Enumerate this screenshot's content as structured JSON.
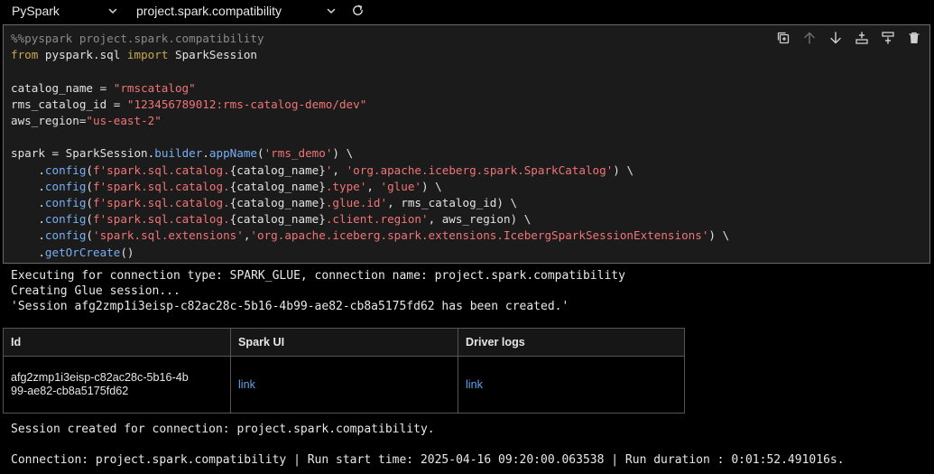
{
  "toolbar": {
    "kernel": "PySpark",
    "connection": "project.spark.compatibility",
    "icons": [
      "chevron-down-icon",
      "refresh-icon"
    ]
  },
  "cell": {
    "actions": [
      {
        "name": "duplicate-cell-icon"
      },
      {
        "name": "move-up-icon"
      },
      {
        "name": "move-down-icon"
      },
      {
        "name": "insert-above-icon"
      },
      {
        "name": "insert-below-icon"
      },
      {
        "name": "delete-icon"
      }
    ],
    "code_lines": [
      [
        {
          "t": "%%pyspark project.spark.compatibility",
          "c": "magic"
        }
      ],
      [
        {
          "t": "from",
          "c": "kw"
        },
        {
          "t": " pyspark.sql ",
          "c": "plain"
        },
        {
          "t": "import",
          "c": "kw"
        },
        {
          "t": " SparkSession",
          "c": "plain"
        }
      ],
      [],
      [
        {
          "t": "catalog_name = ",
          "c": "plain"
        },
        {
          "t": "\"rmscatalog\"",
          "c": "str"
        }
      ],
      [
        {
          "t": "rms_catalog_id = ",
          "c": "plain"
        },
        {
          "t": "\"123456789012:rms-catalog-demo/dev\"",
          "c": "str"
        }
      ],
      [
        {
          "t": "aws_region=",
          "c": "plain"
        },
        {
          "t": "\"us-east-2\"",
          "c": "str"
        }
      ],
      [],
      [
        {
          "t": "spark = SparkSession.",
          "c": "plain"
        },
        {
          "t": "builder",
          "c": "fn"
        },
        {
          "t": ".",
          "c": "plain"
        },
        {
          "t": "appName",
          "c": "fn"
        },
        {
          "t": "(",
          "c": "plain"
        },
        {
          "t": "'rms_demo'",
          "c": "str"
        },
        {
          "t": ") \\",
          "c": "plain"
        }
      ],
      [
        {
          "t": "    .",
          "c": "plain"
        },
        {
          "t": "config",
          "c": "fn"
        },
        {
          "t": "(",
          "c": "plain"
        },
        {
          "t": "f'spark.sql.catalog.",
          "c": "str"
        },
        {
          "t": "{catalog_name}",
          "c": "plain"
        },
        {
          "t": "'",
          "c": "str"
        },
        {
          "t": ", ",
          "c": "plain"
        },
        {
          "t": "'org.apache.iceberg.spark.SparkCatalog'",
          "c": "str"
        },
        {
          "t": ") \\",
          "c": "plain"
        }
      ],
      [
        {
          "t": "    .",
          "c": "plain"
        },
        {
          "t": "config",
          "c": "fn"
        },
        {
          "t": "(",
          "c": "plain"
        },
        {
          "t": "f'spark.sql.catalog.",
          "c": "str"
        },
        {
          "t": "{catalog_name}",
          "c": "plain"
        },
        {
          "t": ".type'",
          "c": "str"
        },
        {
          "t": ", ",
          "c": "plain"
        },
        {
          "t": "'glue'",
          "c": "str"
        },
        {
          "t": ") \\",
          "c": "plain"
        }
      ],
      [
        {
          "t": "    .",
          "c": "plain"
        },
        {
          "t": "config",
          "c": "fn"
        },
        {
          "t": "(",
          "c": "plain"
        },
        {
          "t": "f'spark.sql.catalog.",
          "c": "str"
        },
        {
          "t": "{catalog_name}",
          "c": "plain"
        },
        {
          "t": ".glue.id'",
          "c": "str"
        },
        {
          "t": ", rms_catalog_id) \\",
          "c": "plain"
        }
      ],
      [
        {
          "t": "    .",
          "c": "plain"
        },
        {
          "t": "config",
          "c": "fn"
        },
        {
          "t": "(",
          "c": "plain"
        },
        {
          "t": "f'spark.sql.catalog.",
          "c": "str"
        },
        {
          "t": "{catalog_name}",
          "c": "plain"
        },
        {
          "t": ".client.region'",
          "c": "str"
        },
        {
          "t": ", aws_region) \\",
          "c": "plain"
        }
      ],
      [
        {
          "t": "    .",
          "c": "plain"
        },
        {
          "t": "config",
          "c": "fn"
        },
        {
          "t": "(",
          "c": "plain"
        },
        {
          "t": "'spark.sql.extensions'",
          "c": "str"
        },
        {
          "t": ",",
          "c": "plain"
        },
        {
          "t": "'org.apache.iceberg.spark.extensions.IcebergSparkSessionExtensions'",
          "c": "str"
        },
        {
          "t": ") \\",
          "c": "plain"
        }
      ],
      [
        {
          "t": "    .",
          "c": "plain"
        },
        {
          "t": "getOrCreate",
          "c": "fn"
        },
        {
          "t": "()",
          "c": "plain"
        }
      ]
    ]
  },
  "output": {
    "exec_lines": [
      "Executing for connection type: SPARK_GLUE, connection name: project.spark.compatibility",
      "Creating Glue session...",
      "'Session afg2zmp1i3eisp-c82ac28c-5b16-4b99-ae82-cb8a5175fd62 has been created.'"
    ],
    "table": {
      "headers": [
        "Id",
        "Spark UI",
        "Driver logs"
      ],
      "row": {
        "id": "afg2zmp1i3eisp-c82ac28c-5b16-4b99-ae82-cb8a5175fd62",
        "spark_ui": "link",
        "driver_logs": "link"
      }
    },
    "session_line": "Session created for connection: project.spark.compatibility.",
    "run_line": "Connection: project.spark.compatibility | Run start time: 2025-04-16 09:20:00.063538 | Run duration : 0:01:52.491016s."
  }
}
